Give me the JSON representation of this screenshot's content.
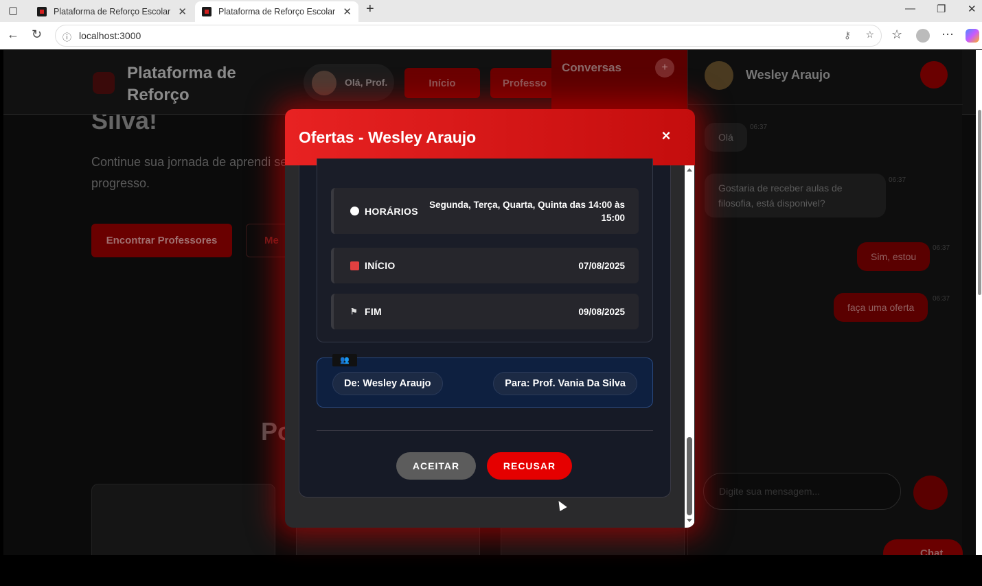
{
  "browser": {
    "tabs": [
      {
        "title": "Plataforma de Reforço Escolar"
      },
      {
        "title": "Plataforma de Reforço Escolar"
      }
    ],
    "url": "localhost:3000"
  },
  "navbar": {
    "brand": "Plataforma de Reforço",
    "greeting": "Olá, Prof.",
    "links": [
      "Início",
      "Professo"
    ]
  },
  "hero": {
    "title_fragment": "Silva!",
    "subtitle": "Continue sua jornada de aprendi seu progresso.",
    "find_button": "Encontrar Professores",
    "second_button": "Me",
    "section_title": "Po"
  },
  "chat": {
    "list_title": "Conversas",
    "contact_name": "Wesley Araujo",
    "messages": [
      {
        "text": "Olá",
        "time": "06:37",
        "direction": "in"
      },
      {
        "text": "Gostaria de receber aulas de filosofia, está disponivel?",
        "time": "06:37",
        "direction": "in"
      },
      {
        "text": "Sim, estou",
        "time": "06:37",
        "direction": "out"
      },
      {
        "text": "faça uma oferta",
        "time": "06:37",
        "direction": "out"
      }
    ],
    "input_placeholder": "Digite sua mensagem...",
    "fab_label": "Chat"
  },
  "modal": {
    "title": "Ofertas - Wesley Araujo",
    "close_label": "×",
    "rows": [
      {
        "icon": "clock-icon",
        "label": "HORÁRIOS",
        "value": "Segunda, Terça, Quarta, Quinta das 14:00 às 15:00"
      },
      {
        "icon": "calendar-icon",
        "label": "INÍCIO",
        "value": "07/08/2025"
      },
      {
        "icon": "flag-icon",
        "label": "FIM",
        "value": "09/08/2025"
      }
    ],
    "from": "De: Wesley Araujo",
    "to": "Para: Prof. Vania Da Silva",
    "accept_label": "ACEITAR",
    "reject_label": "RECUSAR"
  },
  "colors": {
    "accent": "#e50000",
    "modal_header": "#d91515"
  }
}
